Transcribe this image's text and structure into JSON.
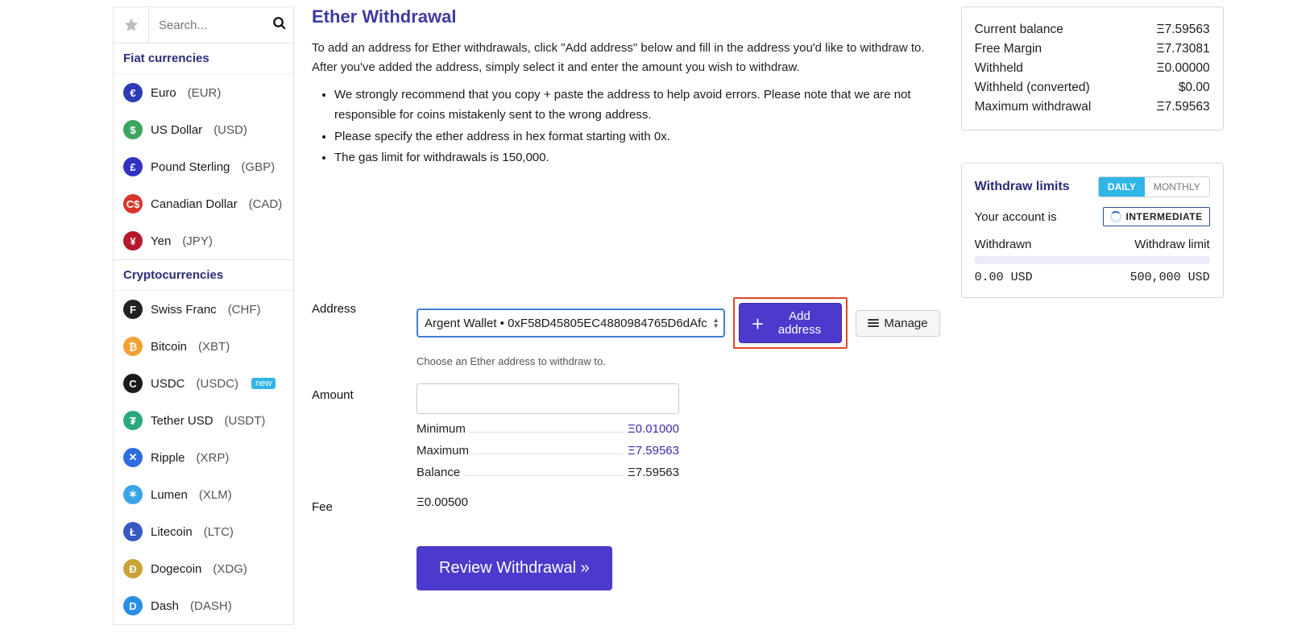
{
  "sidebar": {
    "search_placeholder": "Search...",
    "fiat_label": "Fiat currencies",
    "crypto_label": "Cryptocurrencies",
    "fiat": [
      {
        "name": "Euro",
        "sym": "(EUR)",
        "color": "#2f3bb5",
        "glyph": "€"
      },
      {
        "name": "US Dollar",
        "sym": "(USD)",
        "color": "#3ba55d",
        "glyph": "$"
      },
      {
        "name": "Pound Sterling",
        "sym": "(GBP)",
        "color": "#3131c2",
        "glyph": "£"
      },
      {
        "name": "Canadian Dollar",
        "sym": "(CAD)",
        "color": "#d8352b",
        "glyph": "C$"
      },
      {
        "name": "Yen",
        "sym": "(JPY)",
        "color": "#b5182a",
        "glyph": "¥"
      }
    ],
    "crypto": [
      {
        "name": "Swiss Franc",
        "sym": "(CHF)",
        "color": "#222",
        "glyph": "F"
      },
      {
        "name": "Bitcoin",
        "sym": "(XBT)",
        "color": "#f2a035",
        "glyph": "₿"
      },
      {
        "name": "USDC",
        "sym": "(USDC)",
        "color": "#1b1b1b",
        "glyph": "C",
        "new": "new"
      },
      {
        "name": "Tether USD",
        "sym": "(USDT)",
        "color": "#2aa97e",
        "glyph": "₮"
      },
      {
        "name": "Ripple",
        "sym": "(XRP)",
        "color": "#2f6cdf",
        "glyph": "✕"
      },
      {
        "name": "Lumen",
        "sym": "(XLM)",
        "color": "#3aa4e8",
        "glyph": "✶"
      },
      {
        "name": "Litecoin",
        "sym": "(LTC)",
        "color": "#3858c2",
        "glyph": "Ł"
      },
      {
        "name": "Dogecoin",
        "sym": "(XDG)",
        "color": "#c8a435",
        "glyph": "Ð"
      },
      {
        "name": "Dash",
        "sym": "(DASH)",
        "color": "#2c8fe6",
        "glyph": "D"
      }
    ]
  },
  "center": {
    "title": "Ether Withdrawal",
    "desc": "To add an address for Ether withdrawals, click \"Add address\" below and fill in the address you'd like to withdraw to. After you've added the address, simply select it and enter the amount you wish to withdraw.",
    "notes": [
      "We strongly recommend that you copy + paste the address to help avoid errors. Please note that we are not responsible for coins mistakenly sent to the wrong address.",
      "Please specify the ether address in hex format starting with 0x.",
      "The gas limit for withdrawals is 150,000."
    ],
    "address_label": "Address",
    "address_selected": "Argent Wallet • 0xF58D45805EC4880984765D6dAfc",
    "address_hint": "Choose an Ether address to withdraw to.",
    "add_address_label": "Add address",
    "manage_label": "Manage",
    "amount_label": "Amount",
    "min_label": "Minimum",
    "min_val": "Ξ0.01000",
    "max_label": "Maximum",
    "max_val": "Ξ7.59563",
    "bal_label": "Balance",
    "bal_val": "Ξ7.59563",
    "fee_label": "Fee",
    "fee_val": "Ξ0.00500",
    "review_label": "Review Withdrawal »"
  },
  "right": {
    "balance": [
      {
        "lab": "Current balance",
        "val": "Ξ7.59563"
      },
      {
        "lab": "Free Margin",
        "val": "Ξ7.73081"
      },
      {
        "lab": "Withheld",
        "val": "Ξ0.00000"
      },
      {
        "lab": "Withheld (converted)",
        "val": "$0.00"
      },
      {
        "lab": "Maximum withdrawal",
        "val": "Ξ7.59563"
      }
    ],
    "limits_title": "Withdraw limits",
    "daily_label": "DAILY",
    "monthly_label": "MONTHLY",
    "account_is": "Your account is",
    "tier": "INTERMEDIATE",
    "withdrawn_label": "Withdrawn",
    "withdraw_limit_label": "Withdraw limit",
    "withdrawn_val": "0.00",
    "withdrawn_cur": "USD",
    "limit_val": "500,000",
    "limit_cur": "USD"
  }
}
